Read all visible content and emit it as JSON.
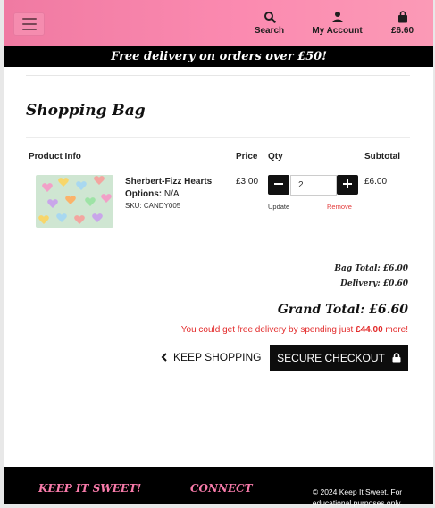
{
  "header": {
    "menu_icon": "hamburger-icon",
    "search_label": "Search",
    "account_label": "My Account",
    "cart_label": "£6.60",
    "accent_color": "#f58caf"
  },
  "promo": {
    "text": "Free delivery on orders over £50!"
  },
  "bag": {
    "title": "Shopping Bag",
    "columns": [
      "Product Info",
      "Price",
      "Qty",
      "Subtotal"
    ],
    "item": {
      "name": "Sherbert-Fizz Hearts",
      "options_label": "Options:",
      "options_value": "N/A",
      "sku": "SKU: CANDY005",
      "price": "£3.00",
      "qty": "2",
      "update_label": "Update",
      "remove_label": "Remove",
      "subtotal": "£6.00"
    },
    "bag_total": "Bag Total: £6.00",
    "delivery": "Delivery: £0.60",
    "grand_total": "Grand Total: £6.60",
    "free_delivery_prefix": "You could get free delivery by spending just ",
    "free_delivery_amount": "£44.00",
    "free_delivery_suffix": " more!",
    "keep_shopping": "KEEP SHOPPING",
    "secure_checkout": "SECURE CHECKOUT"
  },
  "footer": {
    "brand": "KEEP IT SWEET!",
    "connect": "CONNECT",
    "copyright_line1": "© 2024 Keep It Sweet. For",
    "copyright_line2": "educational purposes only."
  }
}
